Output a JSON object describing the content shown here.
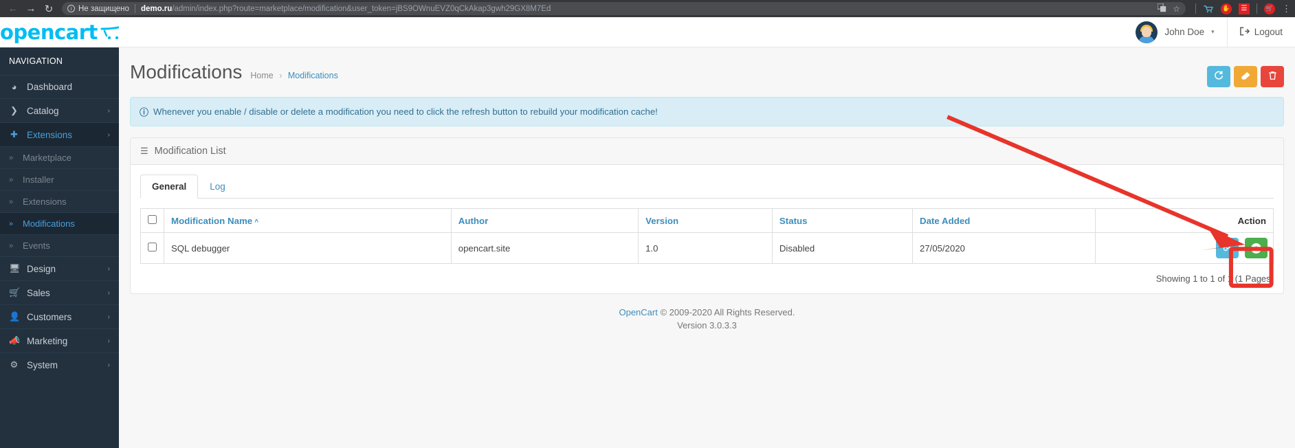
{
  "browser": {
    "back_icon": "←",
    "forward_icon": "→",
    "reload_icon": "↻",
    "security_label": "Не защищено",
    "url_host": "demo.ru",
    "url_path": "/admin/index.php?route=marketplace/modification&user_token=jBS9OWnuEVZ0qCkAkap3gwh29GX8M7Ed",
    "translate_icon": "translate-icon",
    "bookmark_icon": "☆",
    "kebab_icon": "⋮",
    "extensions": [
      "cart-outline-icon",
      "hand-stop-icon",
      "red-layers-icon",
      "shopping-cart-icon"
    ]
  },
  "brand": {
    "name": "opencart"
  },
  "sidebar": {
    "header": "NAVIGATION",
    "items": [
      {
        "label": "Dashboard",
        "icon": "dashboard-icon",
        "type": "item",
        "caret": "",
        "active": false
      },
      {
        "label": "Catalog",
        "icon": "catalog-icon",
        "type": "item",
        "caret": "›",
        "active": false
      },
      {
        "label": "Extensions",
        "icon": "puzzle-icon",
        "type": "item",
        "caret": "›",
        "active": true
      },
      {
        "label": "Marketplace",
        "icon": "chevron-double-icon",
        "type": "sub",
        "active": false
      },
      {
        "label": "Installer",
        "icon": "chevron-double-icon",
        "type": "sub",
        "active": false
      },
      {
        "label": "Extensions",
        "icon": "chevron-double-icon",
        "type": "sub",
        "active": false
      },
      {
        "label": "Modifications",
        "icon": "chevron-double-icon",
        "type": "sub",
        "active": true
      },
      {
        "label": "Events",
        "icon": "chevron-double-icon",
        "type": "sub",
        "active": false
      },
      {
        "label": "Design",
        "icon": "monitor-icon",
        "type": "item",
        "caret": "›",
        "active": false
      },
      {
        "label": "Sales",
        "icon": "cart-icon",
        "type": "item",
        "caret": "›",
        "active": false
      },
      {
        "label": "Customers",
        "icon": "user-icon",
        "type": "item",
        "caret": "›",
        "active": false
      },
      {
        "label": "Marketing",
        "icon": "megaphone-icon",
        "type": "item",
        "caret": "›",
        "active": false
      },
      {
        "label": "System",
        "icon": "gear-icon",
        "type": "item",
        "caret": "›",
        "active": false
      }
    ]
  },
  "topbar": {
    "user_name": "John Doe",
    "user_caret": "▾",
    "logout_label": "Logout",
    "logout_icon": "logout-icon"
  },
  "page": {
    "title": "Modifications",
    "breadcrumb": [
      {
        "label": "Home",
        "current": false
      },
      {
        "label": "Modifications",
        "current": true
      }
    ],
    "breadcrumb_separator": "›",
    "actions": [
      {
        "name": "refresh-button",
        "icon": "↻",
        "color": "#55b9dd"
      },
      {
        "name": "clear-button",
        "icon": "✐",
        "color": "#f0a935"
      },
      {
        "name": "delete-button",
        "icon": "🗑",
        "color": "#e8463c"
      }
    ]
  },
  "alert": {
    "icon": "info-icon",
    "text": "Whenever you enable / disable or delete a modification you need to click the refresh button to rebuild your modification cache!"
  },
  "panel": {
    "icon": "list-icon",
    "title": "Modification List",
    "tabs": [
      {
        "label": "General",
        "active": true
      },
      {
        "label": "Log",
        "active": false
      }
    ],
    "table": {
      "columns": [
        {
          "label": "Modification Name",
          "sort": "^",
          "link": true
        },
        {
          "label": "Author",
          "sort": "",
          "link": true
        },
        {
          "label": "Version",
          "sort": "",
          "link": true
        },
        {
          "label": "Status",
          "sort": "",
          "link": true
        },
        {
          "label": "Date Added",
          "sort": "",
          "link": true
        },
        {
          "label": "Action",
          "sort": "",
          "link": false
        }
      ],
      "rows": [
        {
          "name": "SQL debugger",
          "author": "opencart.site",
          "version": "1.0",
          "status": "Disabled",
          "date_added": "27/05/2020",
          "actions": [
            {
              "name": "link-button",
              "icon": "link-icon",
              "color": "#55b9dd"
            },
            {
              "name": "enable-button",
              "icon": "plus-icon",
              "color": "#4cae4c",
              "highlighted": true
            }
          ]
        }
      ]
    },
    "showing": "Showing 1 to 1 of 1 (1 Pages)"
  },
  "footer": {
    "link_label": "OpenCart",
    "copyright": " © 2009-2020 All Rights Reserved.",
    "version": "Version 3.0.3.3"
  },
  "annotation": {
    "arrow_color": "#e8342a",
    "box_color": "#e8342a"
  }
}
